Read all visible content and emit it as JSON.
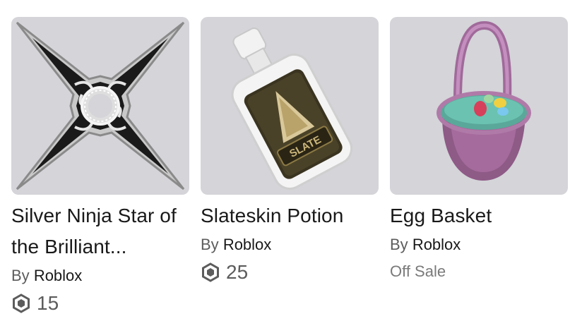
{
  "items": [
    {
      "name": "Silver Ninja Star of the Brilliant...",
      "by_label": "By",
      "creator": "Roblox",
      "price": "15",
      "price_icon": "robux-icon",
      "thumbnail_icon": "ninja-star-icon"
    },
    {
      "name": "Slateskin Potion",
      "by_label": "By",
      "creator": "Roblox",
      "price": "25",
      "price_icon": "robux-icon",
      "thumbnail_icon": "potion-bottle-icon",
      "label_text": "SLATE"
    },
    {
      "name": "Egg Basket",
      "by_label": "By",
      "creator": "Roblox",
      "status": "Off Sale",
      "thumbnail_icon": "egg-basket-icon"
    }
  ],
  "colors": {
    "thumbnail_bg": "#d4d4d9",
    "text_primary": "#191919",
    "text_secondary": "#5c5c5c"
  }
}
